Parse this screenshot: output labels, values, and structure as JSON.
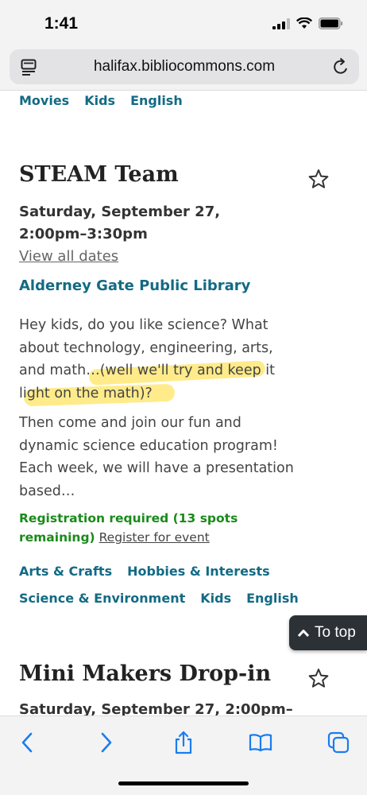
{
  "status": {
    "time": "1:41"
  },
  "browser": {
    "url": "halifax.bibliocommons.com"
  },
  "top_tags": [
    "Movies",
    "Kids",
    "English"
  ],
  "event1": {
    "title": "STEAM Team",
    "date": "Saturday, September 27, 2:00pm–3:30pm",
    "view_all_dates": "View all dates",
    "location": "Alderney Gate Public Library",
    "description_1": "Hey kids, do you like science? What about technology, engineering, arts, and math…(well we'll try and keep it light on the math)?",
    "description_2": "Then come and join our fun and dynamic science education program! Each week, we will have a presentation based…",
    "registration_status": "Registration required (13 spots remaining)",
    "register_link": "Register for event",
    "tags_row1": [
      "Arts & Crafts",
      "Hobbies & Interests"
    ],
    "tags_row2": [
      "Science & Environment",
      "Kids",
      "English"
    ]
  },
  "to_top": {
    "label": "To top"
  },
  "event2": {
    "title": "Mini Makers Drop-in",
    "date": "Saturday, September 27, 2:00pm–"
  },
  "colors": {
    "link": "#136a84",
    "registration": "#1a8a1a",
    "highlight": "#ffde3c",
    "ios_blue": "#1a7cf0"
  }
}
